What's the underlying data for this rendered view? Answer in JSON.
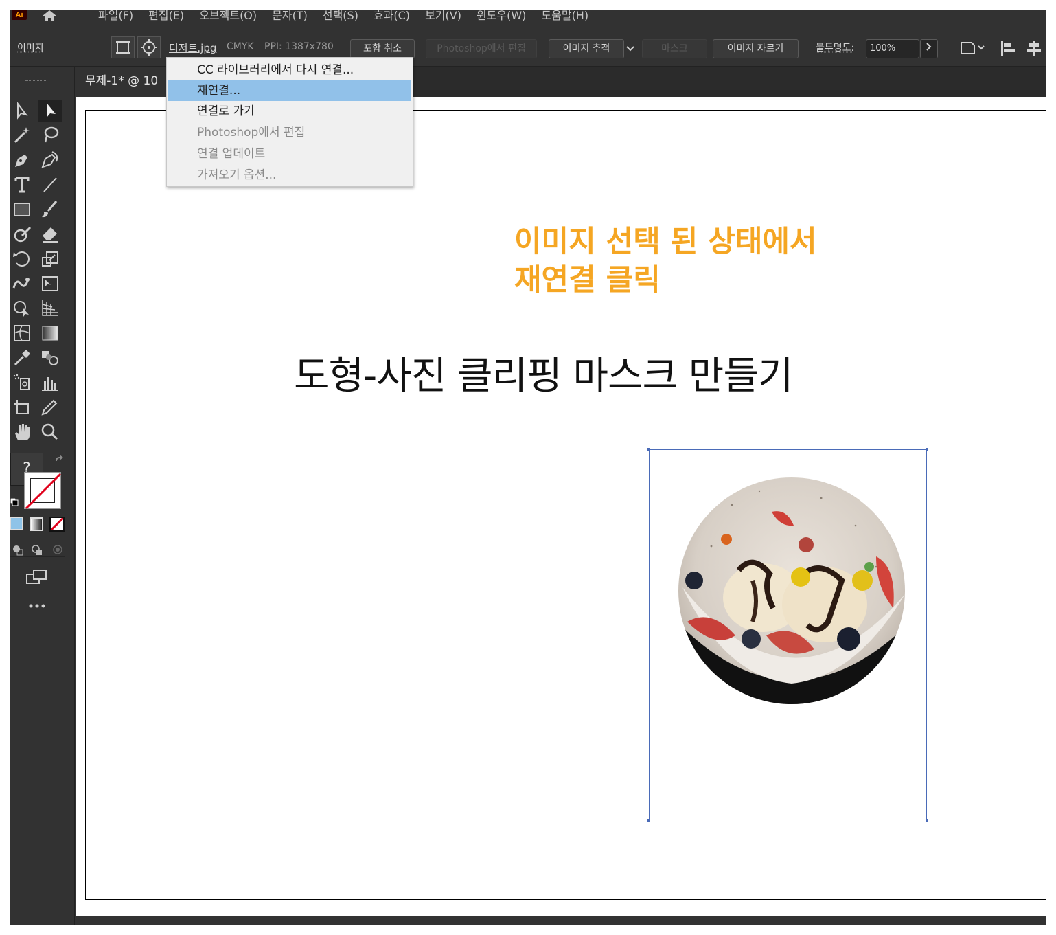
{
  "app": {
    "logo": "Ai",
    "accent": "#ff9a00"
  },
  "menu": [
    {
      "label": "파일(F)"
    },
    {
      "label": "편집(E)"
    },
    {
      "label": "오브젝트(O)"
    },
    {
      "label": "문자(T)"
    },
    {
      "label": "선택(S)"
    },
    {
      "label": "효과(C)"
    },
    {
      "label": "보기(V)"
    },
    {
      "label": "윈도우(W)"
    },
    {
      "label": "도움말(H)"
    }
  ],
  "control_bar": {
    "selection_type": "이미지",
    "file_name": "디저트.jpg",
    "color_mode": "CMYK",
    "ppi": "PPI: 1387x780",
    "embed_cancel": "포함 취소",
    "edit_in_photoshop": "Photoshop에서 편집",
    "image_trace": "이미지 추적",
    "mask": "마스크",
    "crop_image": "이미지 자르기",
    "opacity_label": "불투명도:",
    "opacity_value": "100%"
  },
  "document_tab": {
    "title": "무제-1* @ 10"
  },
  "dropdown": {
    "items": [
      {
        "label": "CC 라이브러리에서 다시 연결...",
        "enabled": true
      },
      {
        "label": "재연결...",
        "enabled": true,
        "highlighted": true
      },
      {
        "label": "연결로 가기",
        "enabled": true
      },
      {
        "label": "Photoshop에서 편집",
        "enabled": false
      },
      {
        "label": "연결 업데이트",
        "enabled": false
      },
      {
        "label": "가져오기 옵션...",
        "enabled": false
      }
    ]
  },
  "artboard": {
    "annotation_line1": "이미지 선택 된 상태에서",
    "annotation_line2": "재연결 클릭",
    "annotation_color": "#f5a623",
    "heading": "도형-사진 클리핑 마스크 만들기"
  },
  "tools_panel": {
    "unknown_fill": "?"
  },
  "selection_color": "#4a6bb8"
}
